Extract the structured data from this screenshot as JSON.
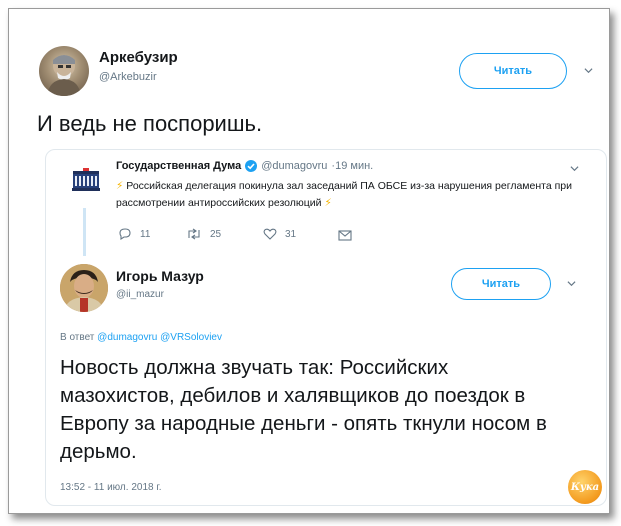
{
  "tweet": {
    "author_name": "Аркебузир",
    "author_handle": "@Arkebuzir",
    "follow_label": "Читать",
    "text": "И ведь не поспоришь."
  },
  "quoted": {
    "author_name": "Государственная Дума",
    "author_handle": "@dumagovru",
    "time": "·19 мин.",
    "text": "Российская делегация покинула зал заседаний ПА ОБСЕ из-за нарушения регламента при рассмотрении антироссийских резолюций",
    "replies": "11",
    "retweets": "25",
    "likes": "31"
  },
  "reply": {
    "author_name": "Игорь Мазур",
    "author_handle": "@ii_mazur",
    "follow_label": "Читать",
    "in_reply_prefix": "В ответ",
    "in_reply_1": "@dumagovru",
    "in_reply_2": "@VRSoloviev",
    "text": "Новость должна звучать так: Российских мазохистов, дебилов и халявщиков до поездок в Европу за народные деньги - опять ткнули носом в дерьмо.",
    "timestamp": "13:52 - 11 июл. 2018 г."
  },
  "watermark": "Кука",
  "colors": {
    "accent": "#1da1f2",
    "verified": "#1da1f2",
    "lightning": "#f5b400"
  }
}
